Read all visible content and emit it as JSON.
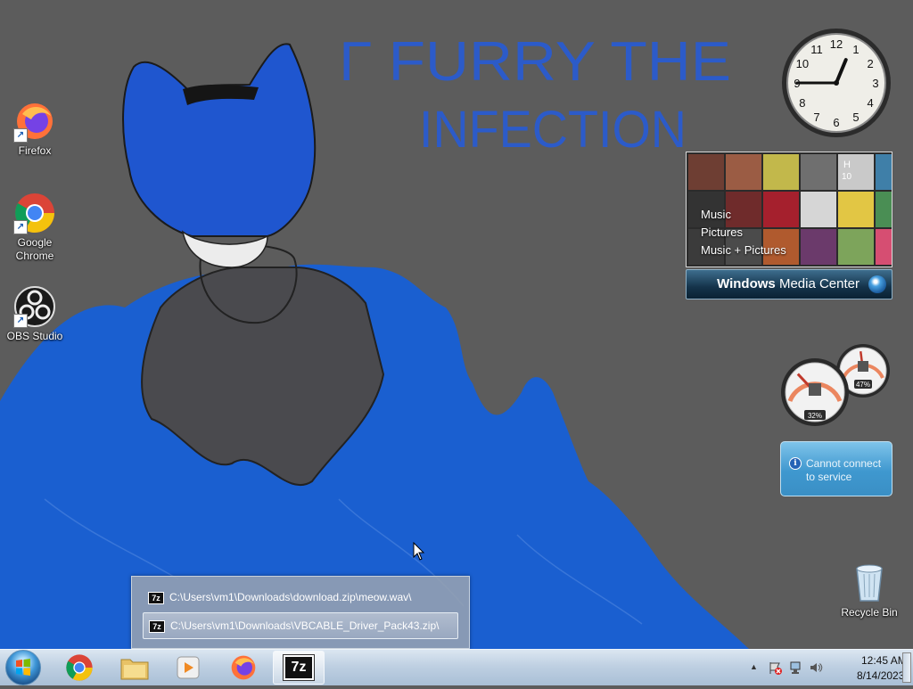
{
  "desktop": {
    "wallpaper_text": [
      "Г FURRY THE",
      "INFECTION"
    ],
    "icons": [
      {
        "label": "Firefox",
        "icon": "firefox-icon"
      },
      {
        "label": "Google Chrome",
        "icon": "chrome-icon"
      },
      {
        "label": "OBS Studio",
        "icon": "obs-icon"
      },
      {
        "label": "Recycle Bin",
        "icon": "recycle-bin-icon"
      }
    ]
  },
  "gadgets": {
    "clock": {
      "time_shown": "12:45",
      "numerals": [
        "12",
        "1",
        "2",
        "3",
        "4",
        "5",
        "6",
        "7",
        "8",
        "9",
        "10",
        "11"
      ]
    },
    "media_center": {
      "links": [
        "Music",
        "Pictures",
        "Music + Pictures"
      ],
      "brand_windows": "Windows",
      "brand_rest": "Media Center",
      "tile_text": [
        "H",
        "10"
      ]
    },
    "cpu_meter": {
      "cpu_percent": 32,
      "memory_percent": 47,
      "cpu_label": "32%",
      "memory_label": "47%"
    },
    "weather": {
      "message": "Cannot connect to service",
      "info_glyph": "i"
    }
  },
  "jump_list": {
    "items": [
      {
        "icon": "7z",
        "path": "C:\\Users\\vm1\\Downloads\\download.zip\\meow.wav\\"
      },
      {
        "icon": "7z",
        "path": "C:\\Users\\vm1\\Downloads\\VBCABLE_Driver_Pack43.zip\\"
      }
    ],
    "selected_index": 1
  },
  "taskbar": {
    "pinned": [
      {
        "name": "chrome",
        "icon": "chrome-icon"
      },
      {
        "name": "explorer",
        "icon": "folder-icon"
      },
      {
        "name": "media-player",
        "icon": "media-player-icon"
      },
      {
        "name": "firefox",
        "icon": "firefox-icon"
      },
      {
        "name": "7-zip",
        "icon": "7zip-icon",
        "label": "7z",
        "active": true
      }
    ],
    "tray": {
      "show_hidden": "▲",
      "time": "12:45 AM",
      "date": "8/14/2023"
    }
  },
  "colors": {
    "taskbar": "#bfd0e2",
    "wallpaper_gray": "#5c5c5c",
    "wallpaper_blue": "#1a5fd0"
  }
}
